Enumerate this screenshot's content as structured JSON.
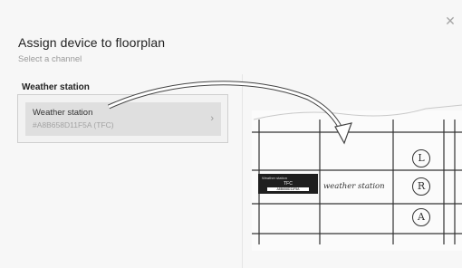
{
  "dialog": {
    "title": "Assign device to floorplan",
    "subtitle": "Select a channel",
    "close_icon": "close-icon"
  },
  "left": {
    "section_label": "Weather station",
    "device": {
      "name": "Weather station",
      "id": "#A8B658D11F5A (TFC)",
      "chevron_icon": "chevron-right-icon"
    }
  },
  "illustration": {
    "tag_title": "Weather station",
    "tag_code": "TFC",
    "tag_id": "A8B658D11F5A",
    "hand_label": "weather station",
    "letters": [
      "L",
      "R",
      "A"
    ]
  }
}
